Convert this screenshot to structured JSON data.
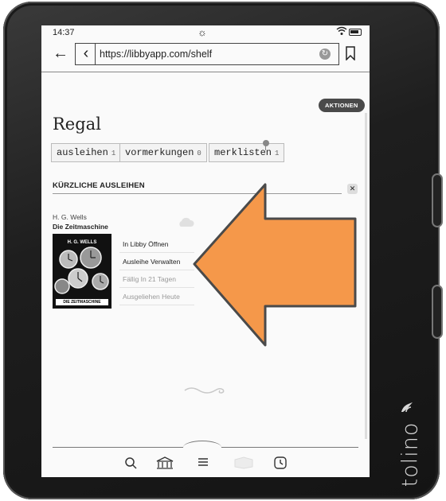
{
  "status": {
    "time": "14:37"
  },
  "browser": {
    "url": "https://libbyapp.com/shelf"
  },
  "header": {
    "action_label": "AKTIONEN",
    "title": "Regal"
  },
  "tabs": [
    {
      "label": "ausleihen",
      "count": "1"
    },
    {
      "label": "vormerkungen",
      "count": "0"
    },
    {
      "label": "merklisten",
      "count": "1"
    }
  ],
  "section": {
    "title": "KÜRZLICHE AUSLEIHEN"
  },
  "loan": {
    "author": "H. G. Wells",
    "title": "Die Zeitmaschine",
    "cover_author": "H. G. WELLS",
    "cover_title": "DIE ZEITMASCHINE",
    "actions": [
      "In Libby Öffnen",
      "Ausleihe Verwalten",
      "Fällig In 21 Tagen",
      "Ausgeliehen Heute"
    ]
  },
  "device": {
    "brand": "tolino"
  },
  "overlay": {
    "arrow_color": "#f5984a",
    "arrow_outline": "#4a4a4a"
  },
  "icons": [
    "sun-icon",
    "wifi-icon",
    "battery-icon",
    "back-arrow-icon",
    "chevron-left-icon",
    "reload-icon",
    "bookmark-icon",
    "cloud-icon",
    "search-icon",
    "library-icon",
    "menu-icon",
    "books-icon",
    "clock-icon"
  ]
}
